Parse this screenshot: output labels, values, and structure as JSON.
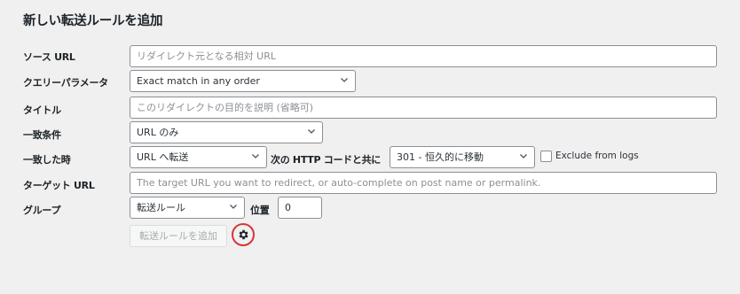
{
  "form": {
    "title": "新しい転送ルールを追加",
    "source_label": "ソース URL",
    "source_placeholder": "リダイレクト元となる相対 URL",
    "query_label": "クエリーパラメータ",
    "query_value": "Exact match in any order",
    "title_label": "タイトル",
    "title_placeholder": "このリダイレクトの目的を説明 (省略可)",
    "match_label": "一致条件",
    "match_value": "URL のみ",
    "when_matched_label": "一致した時",
    "action_value": "URL へ転送",
    "http_code_label": "次の HTTP コードと共に",
    "http_code_value": "301 - 恒久的に移動",
    "exclude_logs_label": "Exclude from logs",
    "exclude_logs_checked": false,
    "target_label": "ターゲット URL",
    "target_placeholder": "The target URL you want to redirect, or auto-complete on post name or permalink.",
    "group_label": "グループ",
    "group_value": "転送ルール",
    "position_label": "位置",
    "position_value": "0",
    "add_button_label": "転送ルールを追加"
  },
  "icons": {
    "dropdown": "chevron-down-icon",
    "settings": "gear-icon"
  },
  "colors": {
    "highlight_circle": "#d63638",
    "placeholder": "#8c8f94",
    "border": "#8c8f94"
  }
}
